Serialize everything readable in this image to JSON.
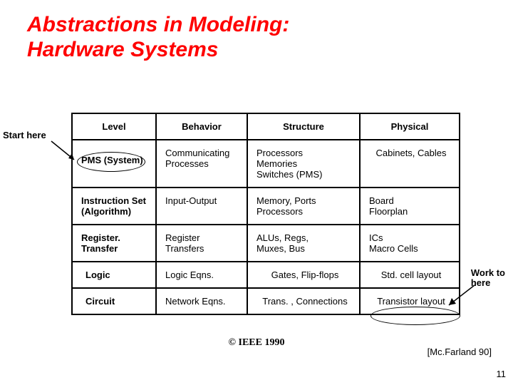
{
  "title_line1": "Abstractions in Modeling:",
  "title_line2": "Hardware Systems",
  "start_here_label": "Start here",
  "work_to_here_line1": "Work to",
  "work_to_here_line2": "here",
  "headers": {
    "level": "Level",
    "behavior": "Behavior",
    "structure": "Structure",
    "physical": "Physical"
  },
  "rows": [
    {
      "level": "PMS (System)",
      "behavior": "Communicating Processes",
      "structure": "Processors Memories Switches (PMS)",
      "physical": "Cabinets, Cables"
    },
    {
      "level": "Instruction Set (Algorithm)",
      "behavior": "Input-Output",
      "structure": "Memory, Ports Processors",
      "physical": "Board Floorplan"
    },
    {
      "level": "Register. Transfer",
      "behavior": "Register Transfers",
      "structure": "ALUs, Regs, Muxes, Bus",
      "physical": "ICs\nMacro Cells"
    },
    {
      "level": "Logic",
      "behavior": "Logic Eqns.",
      "structure": "Gates, Flip-flops",
      "physical": "Std. cell layout"
    },
    {
      "level": "Circuit",
      "behavior": "Network Eqns.",
      "structure": "Trans. , Connections",
      "physical": "Transistor layout"
    }
  ],
  "row0_structure_lines": [
    "Processors",
    "Memories",
    "Switches (PMS)"
  ],
  "row1_structure_lines": [
    "Memory, Ports",
    "Processors"
  ],
  "row2_physical_lines": [
    "ICs",
    "Macro Cells"
  ],
  "row1_physical_lines": [
    "Board",
    "Floorplan"
  ],
  "row0_behavior_lines": [
    "Communicating",
    "Processes"
  ],
  "row1_level_lines": [
    "Instruction Set",
    "(Algorithm)"
  ],
  "row2_level_lines": [
    "Register.",
    "Transfer"
  ],
  "row2_behavior_lines": [
    "Register",
    "Transfers"
  ],
  "row2_structure_lines": [
    "ALUs, Regs,",
    "Muxes, Bus"
  ],
  "copyright": "© IEEE 1990",
  "citation": "[Mc.Farland 90]",
  "page_number": "11"
}
